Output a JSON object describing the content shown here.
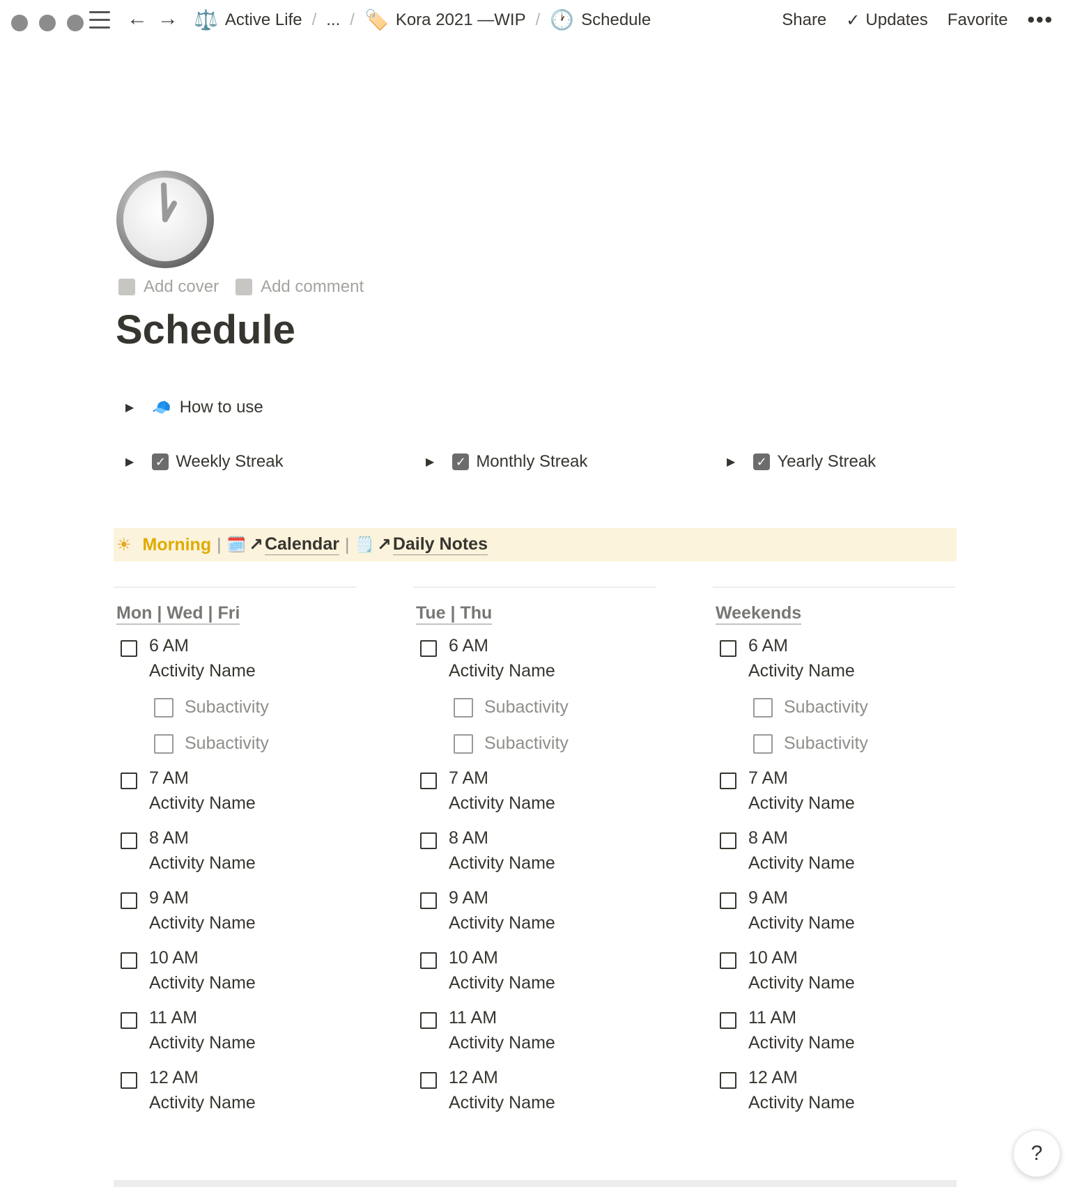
{
  "topbar": {
    "breadcrumbs": [
      {
        "icon": "scales-icon",
        "emoji": "⚖️",
        "label": "Active Life"
      },
      {
        "icon": "",
        "emoji": "",
        "label": "..."
      },
      {
        "icon": "tag-icon",
        "emoji": "🏷️",
        "label": "Kora 2021 —WIP"
      },
      {
        "icon": "clock-icon",
        "emoji": "🕐",
        "label": "Schedule"
      }
    ],
    "share": "Share",
    "updates": "Updates",
    "favorite": "Favorite",
    "more": "•••"
  },
  "page": {
    "icon": "clock-icon",
    "add_cover": "Add cover",
    "add_comment": "Add comment",
    "title": "Schedule"
  },
  "toggles": {
    "how_to_use": {
      "emoji": "🧢",
      "label": "How to use"
    },
    "weekly": "Weekly Streak",
    "monthly": "Monthly Streak",
    "yearly": "Yearly Streak"
  },
  "callout": {
    "morning": "Morning",
    "pipe": "|",
    "calendar": "Calendar",
    "daily_notes": "Daily Notes",
    "arrow": "↗",
    "calendar_emoji": "🗓️",
    "notes_emoji": "🗒️",
    "sun_emoji": "☀",
    "colors": {
      "background": "#fbf3db",
      "accent": "#dfab01"
    }
  },
  "columns": [
    {
      "heading": "Mon | Wed | Fri",
      "slots": [
        {
          "time": "6 AM",
          "name": "Activity Name",
          "subs": [
            "Subactivity",
            "Subactivity"
          ]
        },
        {
          "time": "7 AM",
          "name": "Activity Name"
        },
        {
          "time": "8 AM",
          "name": "Activity Name"
        },
        {
          "time": "9 AM",
          "name": "Activity Name"
        },
        {
          "time": "10 AM",
          "name": "Activity Name"
        },
        {
          "time": "11 AM",
          "name": "Activity Name"
        },
        {
          "time": "12 AM",
          "name": "Activity Name"
        }
      ]
    },
    {
      "heading": "Tue | Thu",
      "slots": [
        {
          "time": "6 AM",
          "name": "Activity Name",
          "subs": [
            "Subactivity",
            "Subactivity"
          ]
        },
        {
          "time": "7 AM",
          "name": "Activity Name"
        },
        {
          "time": "8 AM",
          "name": "Activity Name"
        },
        {
          "time": "9 AM",
          "name": "Activity Name"
        },
        {
          "time": "10 AM",
          "name": "Activity Name"
        },
        {
          "time": "11 AM",
          "name": "Activity Name"
        },
        {
          "time": "12 AM",
          "name": "Activity Name"
        }
      ]
    },
    {
      "heading": "Weekends",
      "slots": [
        {
          "time": "6 AM",
          "name": "Activity Name",
          "subs": [
            "Subactivity",
            "Subactivity"
          ]
        },
        {
          "time": "7 AM",
          "name": "Activity Name"
        },
        {
          "time": "8 AM",
          "name": "Activity Name"
        },
        {
          "time": "9 AM",
          "name": "Activity Name"
        },
        {
          "time": "10 AM",
          "name": "Activity Name"
        },
        {
          "time": "11 AM",
          "name": "Activity Name"
        },
        {
          "time": "12 AM",
          "name": "Activity Name"
        }
      ]
    }
  ],
  "help": "?"
}
